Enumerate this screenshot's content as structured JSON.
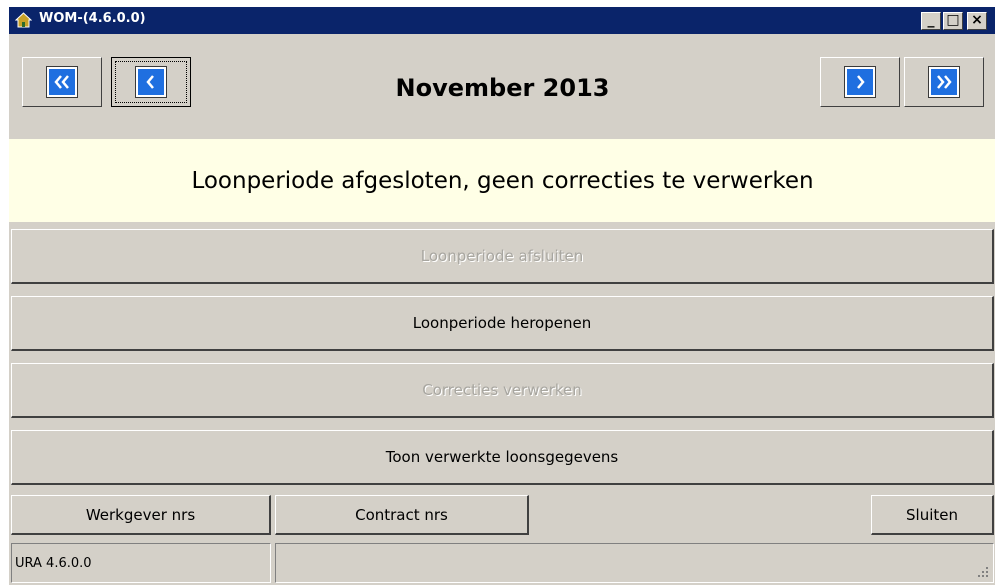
{
  "window": {
    "title": "WOM-(4.6.0.0)",
    "minimize_label": "_",
    "maximize_label": "□",
    "close_label": "×"
  },
  "nav": {
    "month_label": "November 2013",
    "first_icon": "double-chevron-left-icon",
    "prev_icon": "chevron-left-icon",
    "next_icon": "chevron-right-icon",
    "last_icon": "double-chevron-right-icon"
  },
  "banner": {
    "text": "Loonperiode afgesloten, geen correcties te verwerken"
  },
  "actions": [
    {
      "label": "Loonperiode afsluiten",
      "enabled": false
    },
    {
      "label": "Loonperiode heropenen",
      "enabled": true
    },
    {
      "label": "Correcties verwerken",
      "enabled": false
    },
    {
      "label": "Toon verwerkte loonsgegevens",
      "enabled": true
    }
  ],
  "footer_buttons": {
    "werkgever": "Werkgever nrs",
    "contract": "Contract nrs",
    "sluiten": "Sluiten"
  },
  "statusbar": {
    "version": "URA 4.6.0.0"
  },
  "colors": {
    "titlebar": "#0a246a",
    "nav_button": "#1f6fe0",
    "banner_bg": "#ffffe6",
    "window_bg": "#d4d0c8"
  }
}
